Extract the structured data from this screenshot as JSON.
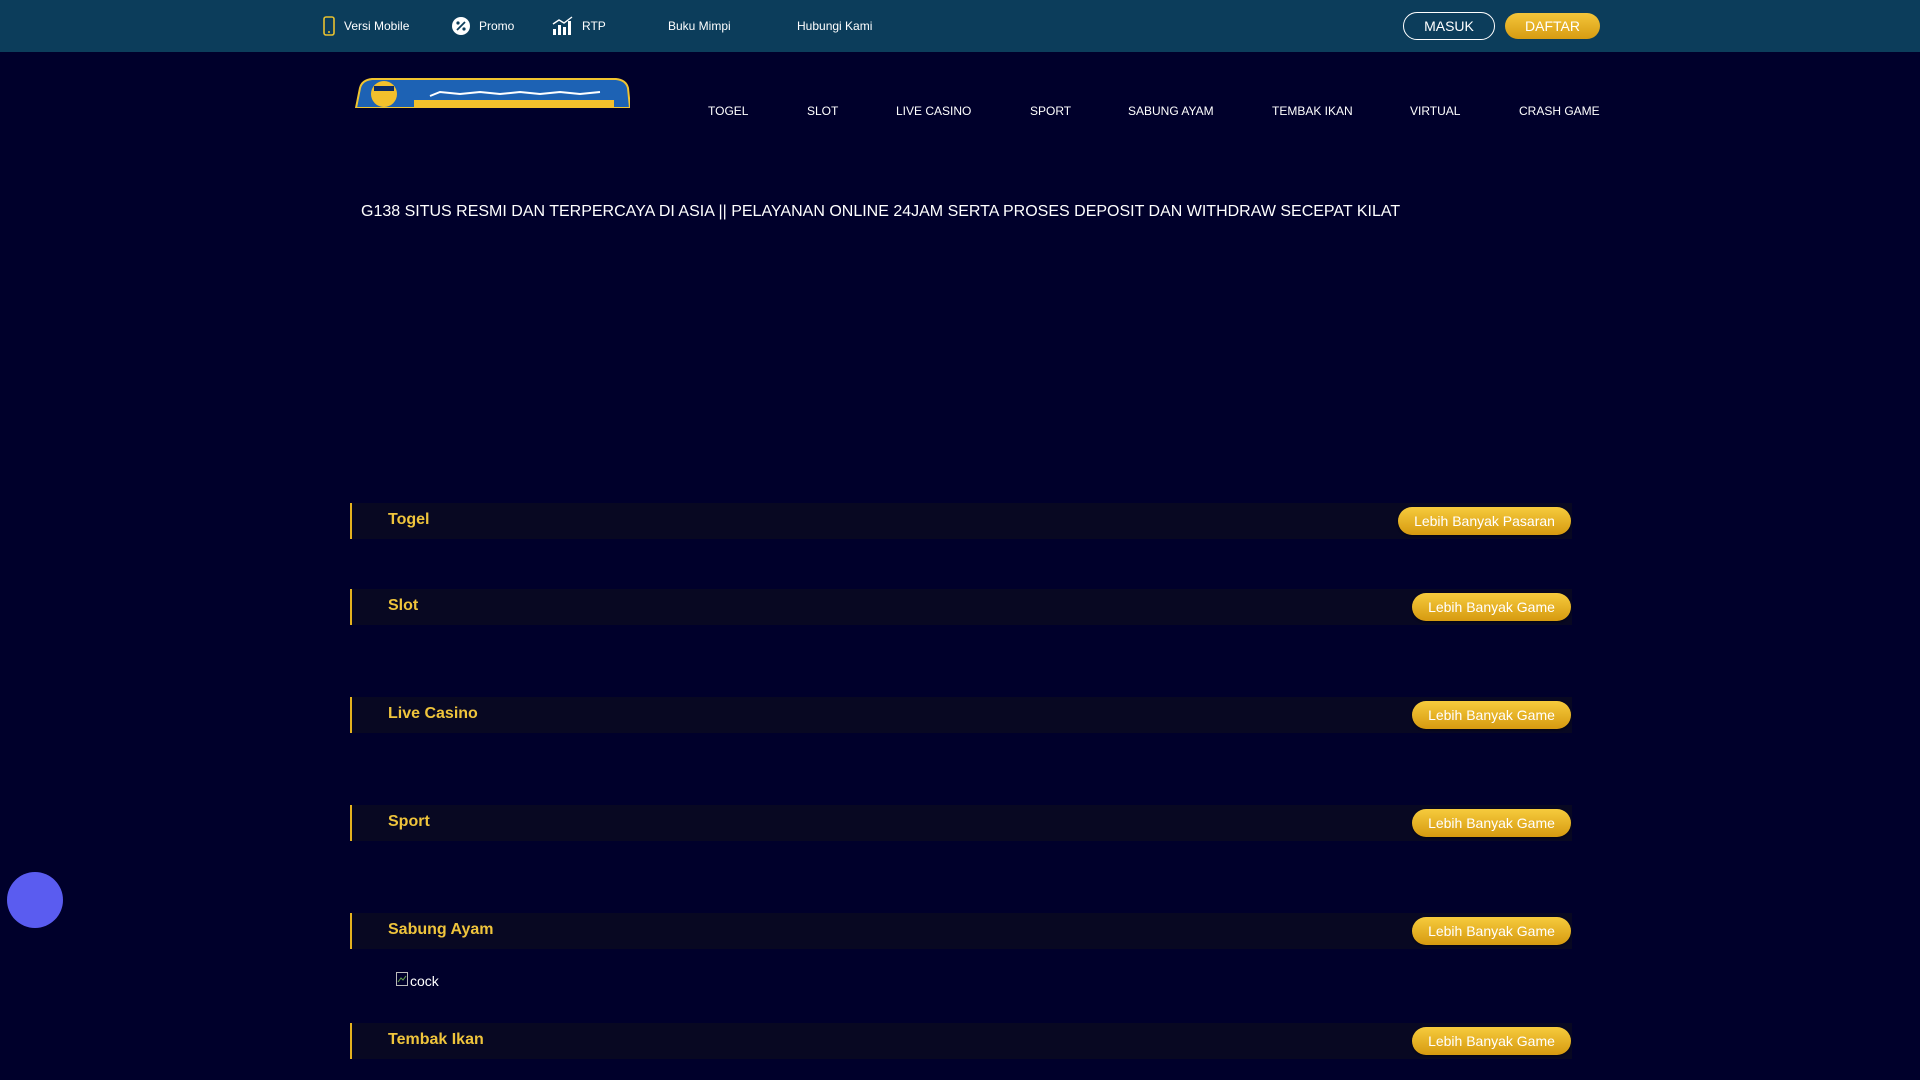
{
  "topbar": {
    "links": [
      {
        "label": "Versi Mobile",
        "icon": "mobile-phone-icon"
      },
      {
        "label": "Promo",
        "icon": "percent-badge-icon"
      },
      {
        "label": "RTP",
        "icon": "bar-chart-icon"
      },
      {
        "label": "Buku Mimpi"
      },
      {
        "label": "Hubungi Kami"
      }
    ],
    "masuk_label": "MASUK",
    "daftar_label": "DAFTAR"
  },
  "nav": {
    "items": [
      "TOGEL",
      "SLOT",
      "LIVE CASINO",
      "SPORT",
      "SABUNG AYAM",
      "TEMBAK IKAN",
      "VIRTUAL",
      "CRASH GAME"
    ]
  },
  "marquee": {
    "text": "G138 SITUS RESMI DAN TERPERCAYA DI ASIA || PELAYANAN ONLINE 24JAM SERTA PROSES DEPOSIT DAN WITHDRAW SECEPAT KILAT"
  },
  "sections": [
    {
      "title": "Togel",
      "button": "Lebih Banyak Pasaran"
    },
    {
      "title": "Slot",
      "button": "Lebih Banyak Game"
    },
    {
      "title": "Live Casino",
      "button": "Lebih Banyak Game"
    },
    {
      "title": "Sport",
      "button": "Lebih Banyak Game"
    },
    {
      "title": "Sabung Ayam",
      "button": "Lebih Banyak Game"
    },
    {
      "title": "Tembak Ikan",
      "button": "Lebih Banyak Game"
    }
  ],
  "broken_image": {
    "alt": "cock"
  },
  "colors": {
    "topbar": "#0c3d5b",
    "background": "#00002b",
    "gold": "#efc43c",
    "chat_button": "#5a5cf0"
  }
}
